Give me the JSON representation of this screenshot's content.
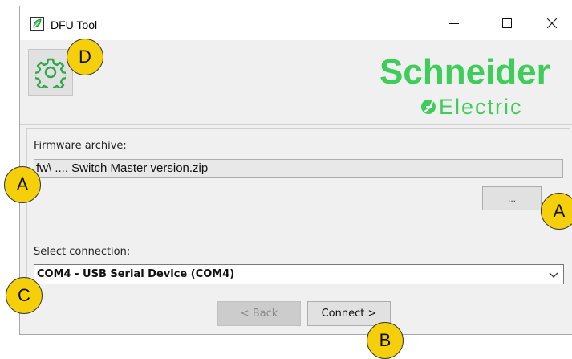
{
  "window": {
    "title": "DFU Tool"
  },
  "logo": {
    "brand_top": "Schneider",
    "brand_bottom": "Electric",
    "color": "#3dcd58"
  },
  "firmware": {
    "label": "Firmware archive:",
    "value": "fw\\ .... Switch Master version.zip",
    "browse_label": "..."
  },
  "connection": {
    "label": "Select connection:",
    "selected": "COM4 - USB Serial Device (COM4)"
  },
  "nav": {
    "back_label": "< Back",
    "connect_label": "Connect >"
  },
  "badges": {
    "a1": "A",
    "a2": "A",
    "b": "B",
    "c": "C",
    "d": "D",
    "color": "#f5d00a"
  },
  "icons": [
    "app-icon",
    "minimize-icon",
    "maximize-icon",
    "close-icon",
    "gear-icon",
    "chevron-down-icon"
  ]
}
